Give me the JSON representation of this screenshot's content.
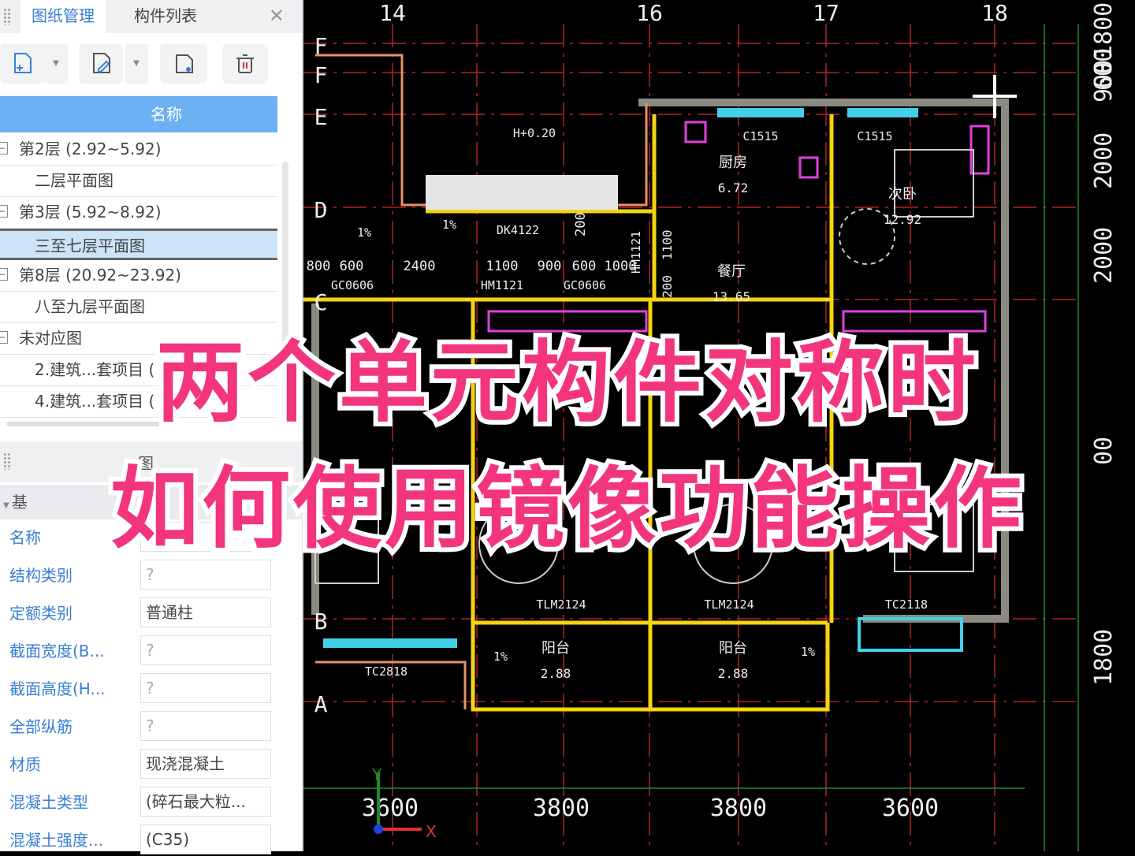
{
  "panel": {
    "tabs": [
      {
        "label": "图纸管理"
      },
      {
        "label": "构件列表"
      }
    ],
    "close_icon": "close-icon",
    "toolbar": [
      "add-drawing-icon",
      "edit-drawing-icon",
      "export-drawing-icon",
      "delete-icon"
    ],
    "header": "名称",
    "tree": [
      {
        "label": "第2层 (2.92~5.92)",
        "type": "group"
      },
      {
        "label": "二层平面图",
        "type": "child"
      },
      {
        "label": "第3层 (5.92~8.92)",
        "type": "group"
      },
      {
        "label": "三至七层平面图",
        "type": "child",
        "selected": true
      },
      {
        "label": "第8层 (20.92~23.92)",
        "type": "group"
      },
      {
        "label": "八至九层平面图",
        "type": "child"
      },
      {
        "label": "未对应图",
        "type": "group"
      },
      {
        "label": "2.建筑...套项目 (",
        "type": "child"
      },
      {
        "label": "4.建筑...套项目 (",
        "type": "child"
      }
    ],
    "section_title": "图",
    "group_label": "基",
    "properties": [
      {
        "label": "名称",
        "value": "?"
      },
      {
        "label": "结构类别",
        "value": "?"
      },
      {
        "label": "定额类别",
        "value": "普通柱"
      },
      {
        "label": "截面宽度(B...",
        "value": "?"
      },
      {
        "label": "截面高度(H...",
        "value": "?"
      },
      {
        "label": "全部纵筋",
        "value": "?"
      },
      {
        "label": "材质",
        "value": "现浇混凝土"
      },
      {
        "label": "混凝土类型",
        "value": "(碎石最大粒..."
      },
      {
        "label": "混凝土强度...",
        "value": "(C35)"
      }
    ]
  },
  "cad": {
    "axes_top": [
      "14",
      "16",
      "17",
      "18"
    ],
    "axes_left": [
      "F",
      "F",
      "E",
      "D",
      "C",
      "B",
      "A"
    ],
    "dims_bottom": [
      "3600",
      "3800",
      "3800",
      "3600"
    ],
    "dims_right": [
      "1800",
      "600",
      "900",
      "2000",
      "2000",
      "00",
      "1800"
    ],
    "dims_inner": [
      "800",
      "600",
      "2400",
      "1100",
      "900",
      "600",
      "1000",
      "200",
      "1100",
      "200"
    ],
    "rooms": [
      {
        "name": "厨房",
        "area": "6.72"
      },
      {
        "name": "次卧",
        "area": "12.92"
      },
      {
        "name": "餐厅",
        "area": "13.65"
      },
      {
        "name": "阳台",
        "area": "2.88"
      },
      {
        "name": "阳台",
        "area": "2.88"
      }
    ],
    "tags": [
      "C1515",
      "C1515",
      "H+0.20",
      "DK4122",
      "GC0606",
      "HM1121",
      "GC0606",
      "TLM2124",
      "TLM2124",
      "TC2118",
      "TC2818",
      "HM1121",
      "1%",
      "1%",
      "1%",
      "1%"
    ],
    "ucs": {
      "y": "Y",
      "x": "X"
    },
    "colors": {
      "wall": "#f5d40e",
      "grid": "#c0282a",
      "column": "#8a8a80",
      "furniture": "#e040e0",
      "window": "#40d0e8"
    }
  },
  "overlay": {
    "line1": "两个单元构件对称时",
    "line2": "如何使用镜像功能操作"
  }
}
